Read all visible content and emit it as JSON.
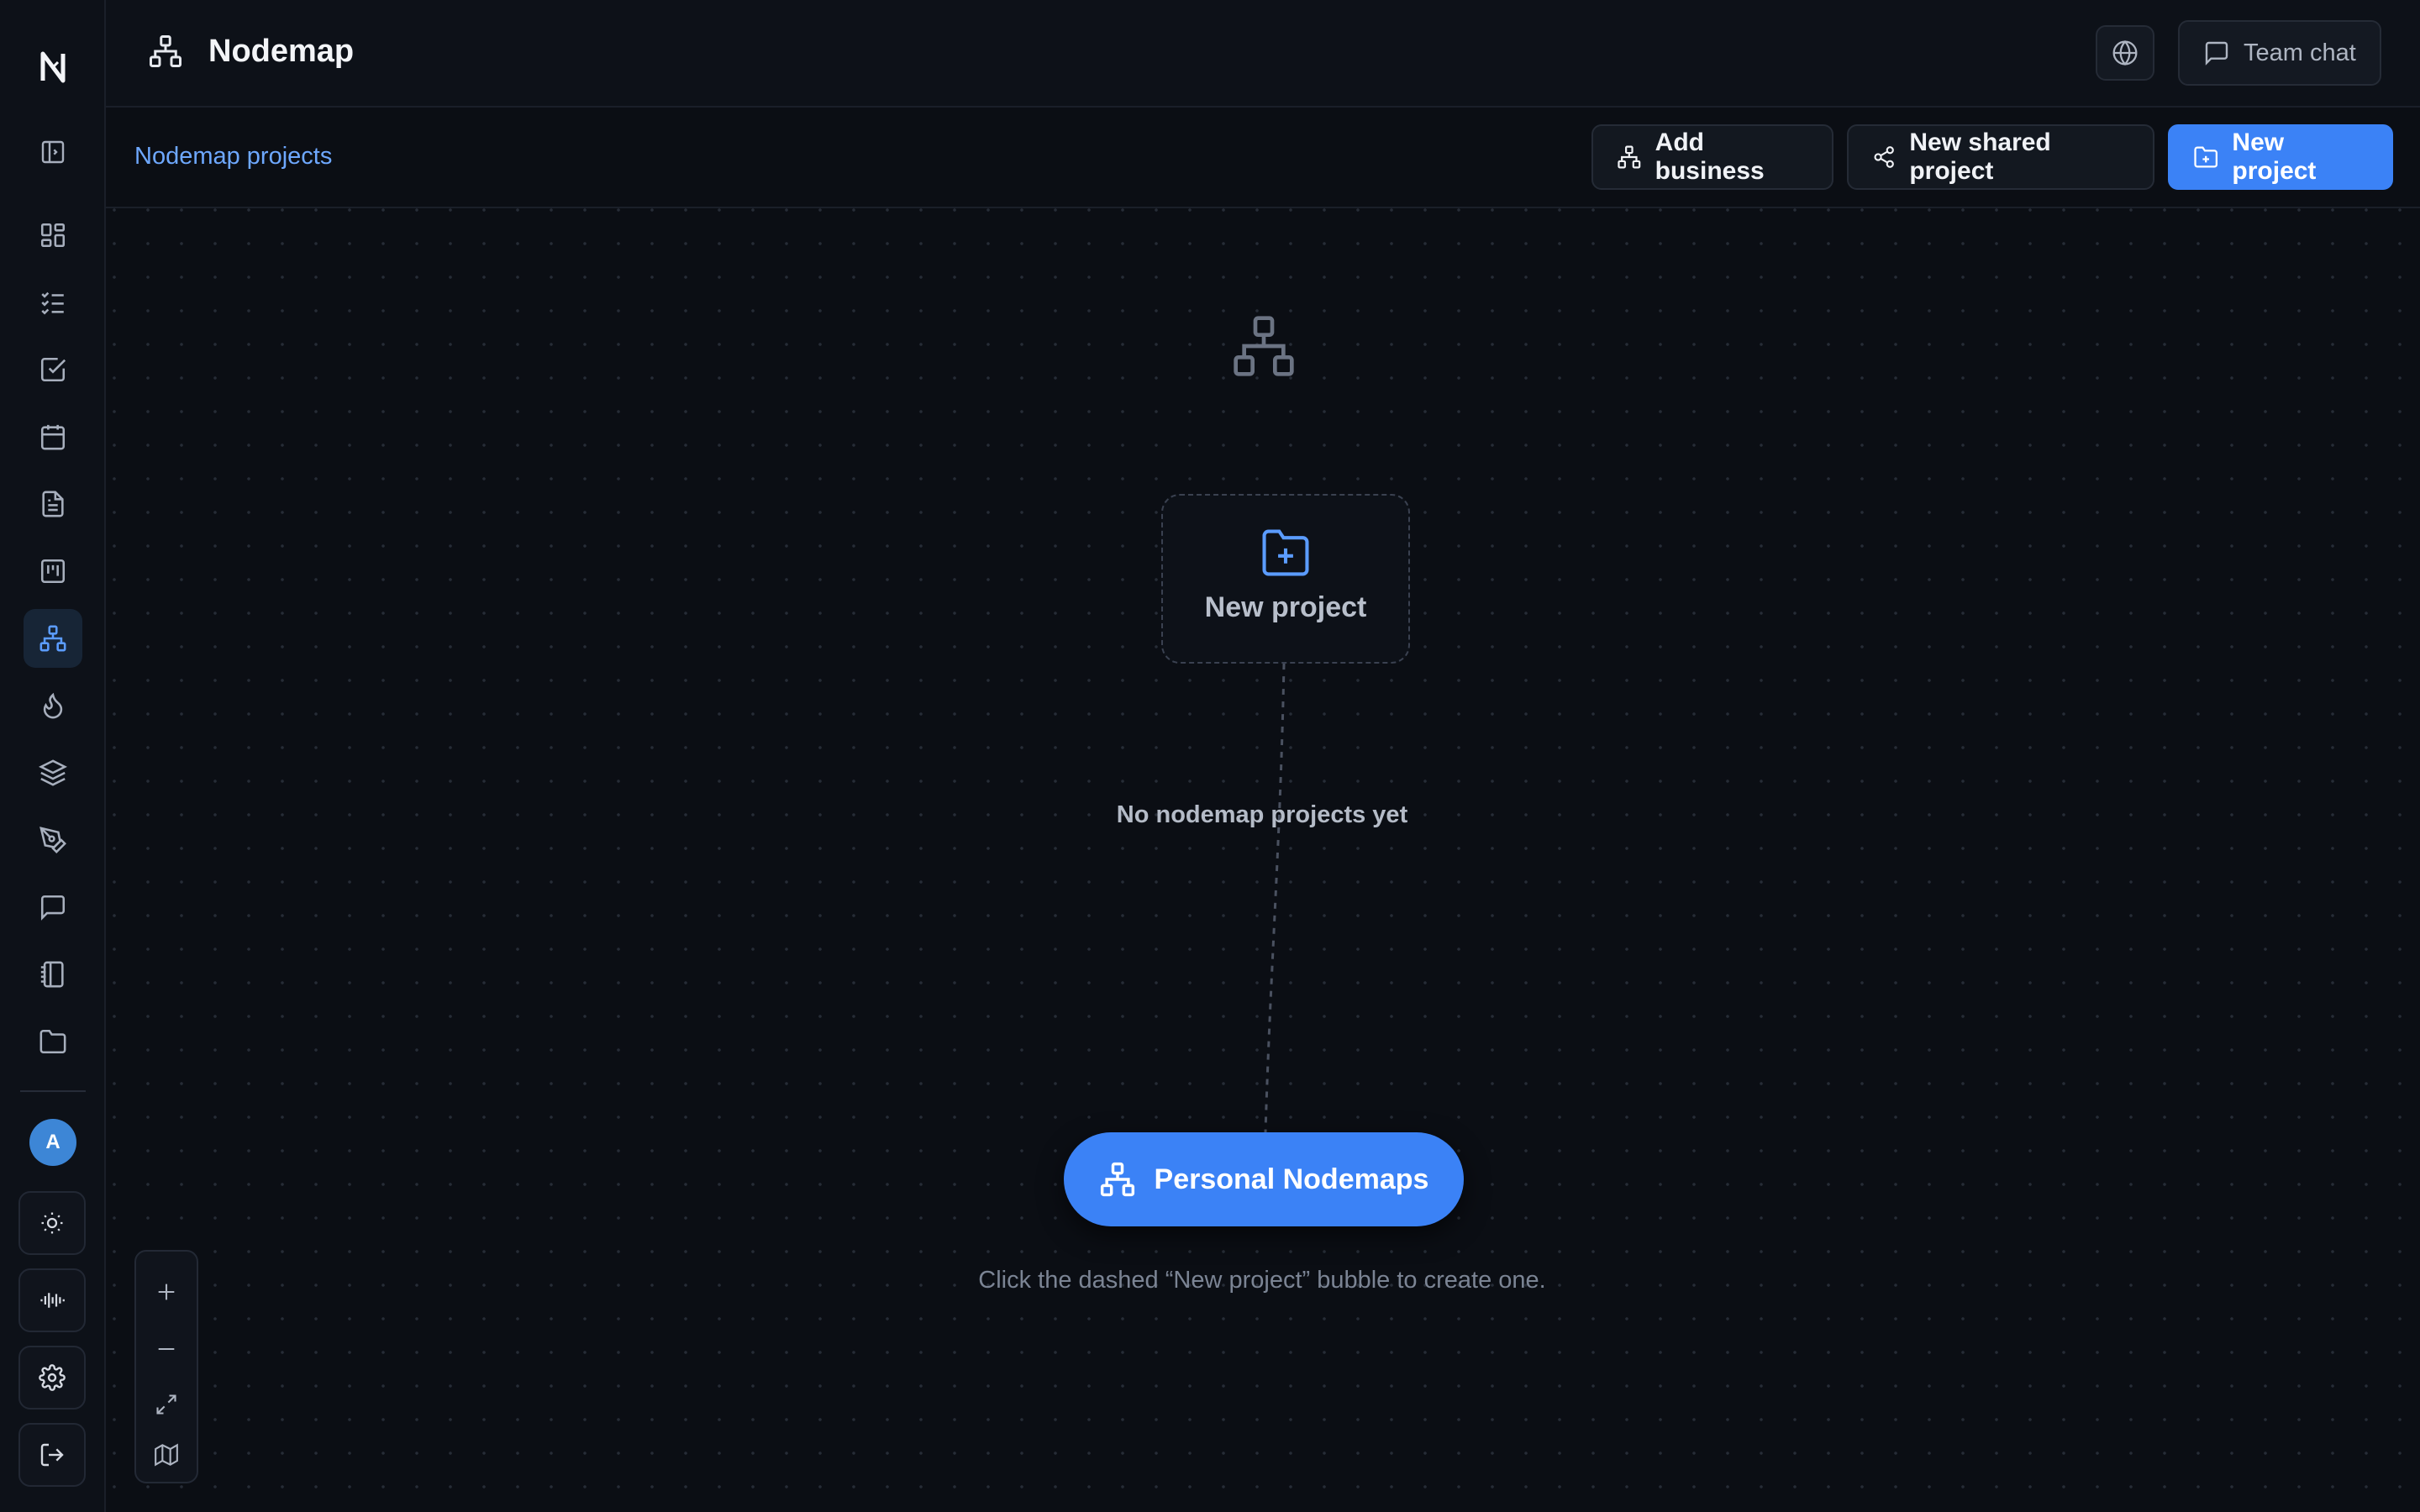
{
  "app": {
    "title": "Nodemap"
  },
  "header": {
    "team_chat_label": "Team chat"
  },
  "breadcrumb": {
    "label": "Nodemap projects"
  },
  "actions": {
    "add_business": "Add business",
    "new_shared_project": "New shared project",
    "new_project": "New project"
  },
  "sidebar": {
    "logo": "N",
    "avatar_initial": "A",
    "items": [
      {
        "icon": "panel-toggle-icon"
      },
      {
        "icon": "dashboard-icon"
      },
      {
        "icon": "checklist-icon"
      },
      {
        "icon": "checkbox-icon"
      },
      {
        "icon": "calendar-icon"
      },
      {
        "icon": "document-icon"
      },
      {
        "icon": "kanban-icon"
      },
      {
        "icon": "nodemap-icon",
        "active": true
      },
      {
        "icon": "flame-icon"
      },
      {
        "icon": "layers-icon"
      },
      {
        "icon": "pen-tool-icon"
      },
      {
        "icon": "message-icon"
      },
      {
        "icon": "notebook-icon"
      },
      {
        "icon": "folder-icon"
      }
    ],
    "bottom": [
      {
        "icon": "sun-icon"
      },
      {
        "icon": "audio-wave-icon"
      },
      {
        "icon": "settings-icon"
      },
      {
        "icon": "logout-icon"
      }
    ]
  },
  "canvas": {
    "new_bubble_label": "New project",
    "empty_title": "No nodemap projects yet",
    "personal_button": "Personal Nodemaps",
    "hint": "Click the dashed “New project” bubble to create one."
  },
  "colors": {
    "background": "#0b0e14",
    "accent": "#3b82f6",
    "link": "#6ea8ff"
  }
}
